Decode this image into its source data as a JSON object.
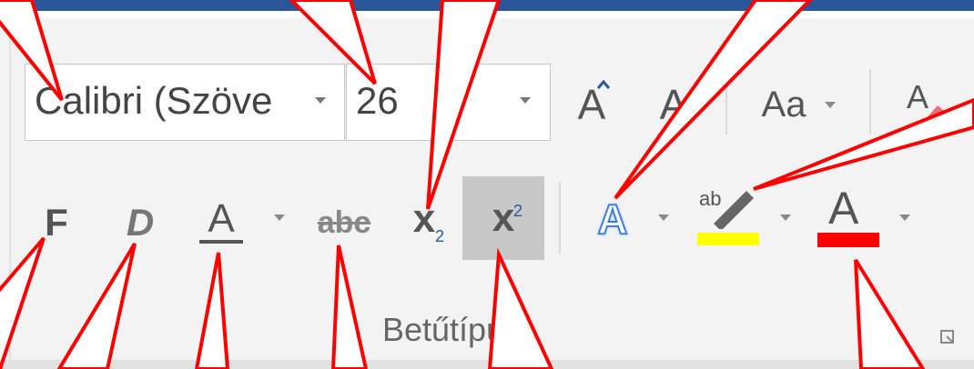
{
  "font_group": {
    "font_name": "Calibri (Szöve",
    "font_size": "26",
    "grow_font_glyph": "A",
    "shrink_font_glyph": "A",
    "change_case_label": "Aa",
    "clear_format_glyph": "A"
  },
  "formatting": {
    "bold": "F",
    "italic": "D",
    "underline": "A",
    "strikethrough": "abc",
    "subscript_base": "x",
    "subscript_mark": "2",
    "superscript_base": "x",
    "superscript_mark": "2",
    "text_effects": "A",
    "highlight_label": "ab",
    "font_color": "A"
  },
  "group_label": "Betűtípus",
  "colors": {
    "ribbon_blue": "#2b579a",
    "highlight": "#ffff00",
    "font_color": "#ff0000",
    "callout_line": "#ff0000",
    "superscript_active_bg": "#c8c8c8"
  }
}
